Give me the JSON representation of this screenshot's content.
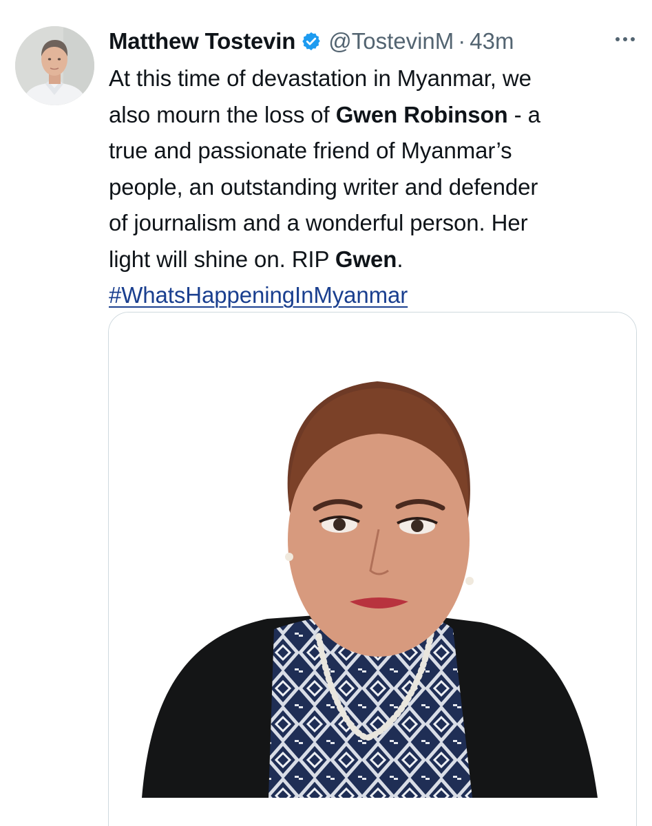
{
  "tweet": {
    "author_name": "Matthew Tostevin",
    "handle": "@TostevinM",
    "separator": "·",
    "time": "43m",
    "text_lines": [
      [
        "At this time of devastation in Myanmar, we",
        "",
        ""
      ],
      [
        "also mourn the loss of ",
        "Gwen Robinson",
        " - a"
      ],
      [
        "true and passionate friend of Myanmar’s",
        "",
        ""
      ],
      [
        "people, an outstanding writer and defender",
        "",
        ""
      ],
      [
        "of journalism and a wonderful person. Her",
        "",
        ""
      ],
      [
        "light will shine on. RIP ",
        "Gwen",
        "."
      ]
    ],
    "hashtag": "#WhatsHappeningInMyanmar"
  },
  "icons": {
    "verified": "verified-badge-icon",
    "more": "more-options-icon"
  },
  "colors": {
    "verified_badge": "#1d9bf0",
    "secondary_text": "#536471",
    "hashtag": "#1a3f8f",
    "card_border": "#cfd9de"
  }
}
